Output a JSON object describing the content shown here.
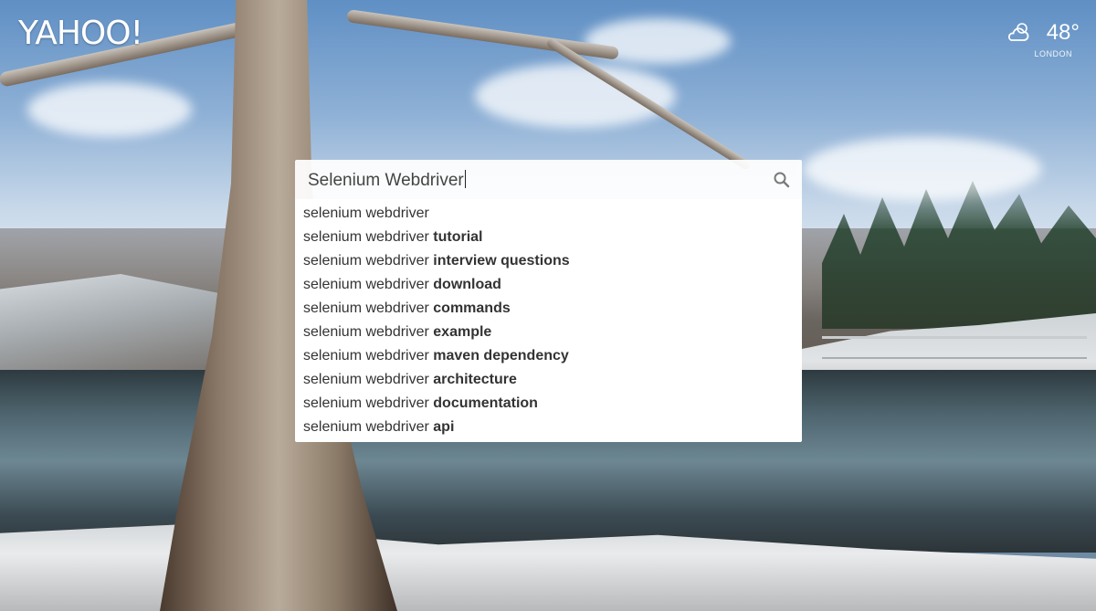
{
  "header": {
    "logo": "YAHOO!"
  },
  "weather": {
    "temperature": "48°",
    "city": "LONDON",
    "icon": "cloudy-icon"
  },
  "search": {
    "value": "Selenium Webdriver",
    "icon": "search-icon"
  },
  "suggestions": [
    {
      "prefix": "selenium webdriver",
      "suffix": ""
    },
    {
      "prefix": "selenium webdriver ",
      "suffix": "tutorial"
    },
    {
      "prefix": "selenium webdriver ",
      "suffix": "interview questions"
    },
    {
      "prefix": "selenium webdriver ",
      "suffix": "download"
    },
    {
      "prefix": "selenium webdriver ",
      "suffix": "commands"
    },
    {
      "prefix": "selenium webdriver ",
      "suffix": "example"
    },
    {
      "prefix": "selenium webdriver ",
      "suffix": "maven dependency"
    },
    {
      "prefix": "selenium webdriver ",
      "suffix": "architecture"
    },
    {
      "prefix": "selenium webdriver ",
      "suffix": "documentation"
    },
    {
      "prefix": "selenium webdriver ",
      "suffix": "api"
    }
  ]
}
